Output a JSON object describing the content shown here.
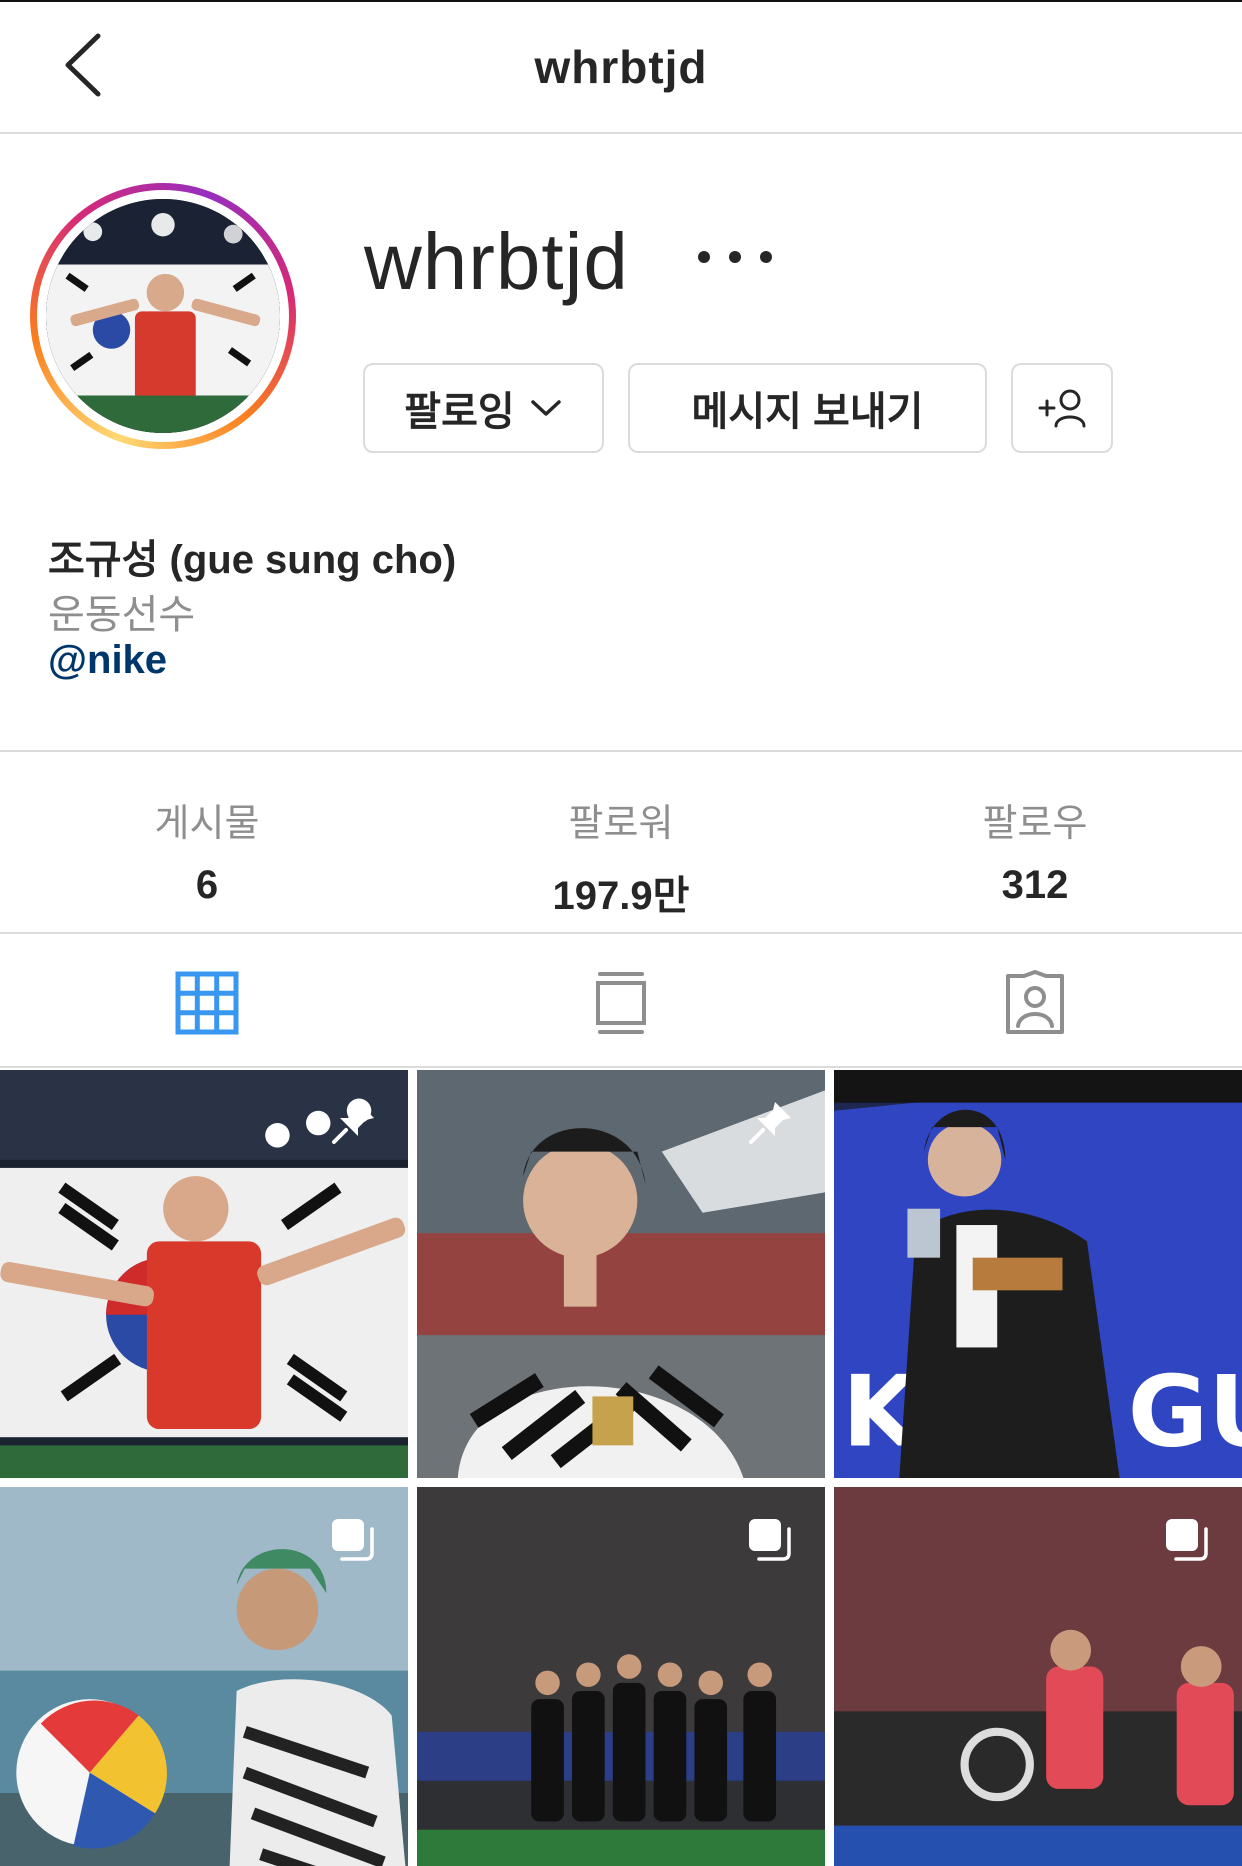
{
  "header": {
    "title": "whrbtjd",
    "back_icon": "chevron-left-icon"
  },
  "profile": {
    "username": "whrbtjd",
    "more_icon": "ellipsis-icon",
    "buttons": {
      "follow_label": "팔로잉",
      "message_label": "메시지 보내기",
      "add_user_icon": "person-add-icon"
    },
    "full_name": "조규성 (gue sung cho)",
    "category": "운동선수",
    "link": "@nike"
  },
  "stats": [
    {
      "label": "게시물",
      "value": "6"
    },
    {
      "label": "팔로워",
      "value": "197.9만"
    },
    {
      "label": "팔로우",
      "value": "312"
    }
  ],
  "tabs": [
    {
      "icon": "grid-icon",
      "active": true
    },
    {
      "icon": "feed-icon",
      "active": false
    },
    {
      "icon": "tagged-icon",
      "active": false
    }
  ],
  "posts": [
    {
      "subject": "player with korean flag",
      "badge": "pin-icon"
    },
    {
      "subject": "player in zebra jersey",
      "badge": "pin-icon"
    },
    {
      "subject": "player with trophy",
      "badge": ""
    },
    {
      "subject": "man with beach ball",
      "badge": "carousel-icon"
    },
    {
      "subject": "team huddle on pitch",
      "badge": "carousel-icon"
    },
    {
      "subject": "players in red kits",
      "badge": "carousel-icon"
    }
  ],
  "colors": {
    "accent": "#3897f0",
    "link": "#00376b",
    "border": "#dbdbdb",
    "muted": "#8e8e8e",
    "text": "#262626"
  }
}
